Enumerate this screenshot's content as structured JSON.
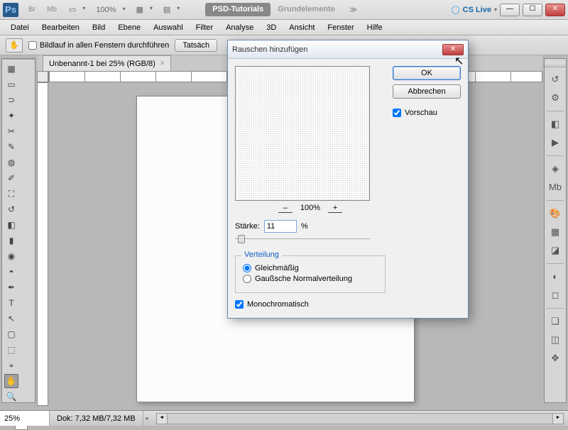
{
  "app": {
    "logo": "Ps"
  },
  "titlebar": {
    "br": "Br",
    "mb": "Mb",
    "zoom": "100%",
    "tabs": {
      "ws1": "PSD-Tutorials",
      "ws2": "Grundelemente"
    },
    "more": "≫",
    "cslive": "CS Live"
  },
  "menu": {
    "datei": "Datei",
    "bearbeiten": "Bearbeiten",
    "bild": "Bild",
    "ebene": "Ebene",
    "auswahl": "Auswahl",
    "filter": "Filter",
    "analyse": "Analyse",
    "dd": "3D",
    "ansicht": "Ansicht",
    "fenster": "Fenster",
    "hilfe": "Hilfe"
  },
  "options": {
    "scrollall": "Bildlauf in allen Fenstern durchführen",
    "btn1": "Tatsäch"
  },
  "doc": {
    "tab": "Unbenannt-1 bei 25% (RGB/8)"
  },
  "status": {
    "zoom": "25%",
    "info": "Dok: 7,32 MB/7,32 MB"
  },
  "dialog": {
    "title": "Rauschen hinzufügen",
    "ok": "OK",
    "cancel": "Abbrechen",
    "preview_label": "Vorschau",
    "zoom_pct": "100%",
    "amount_label": "Stärke:",
    "amount_value": "11",
    "amount_unit": "%",
    "dist_legend": "Verteilung",
    "dist_uniform": "Gleichmäßig",
    "dist_gauss": "Gaußsche Normalverteilung",
    "mono": "Monochromatisch"
  }
}
